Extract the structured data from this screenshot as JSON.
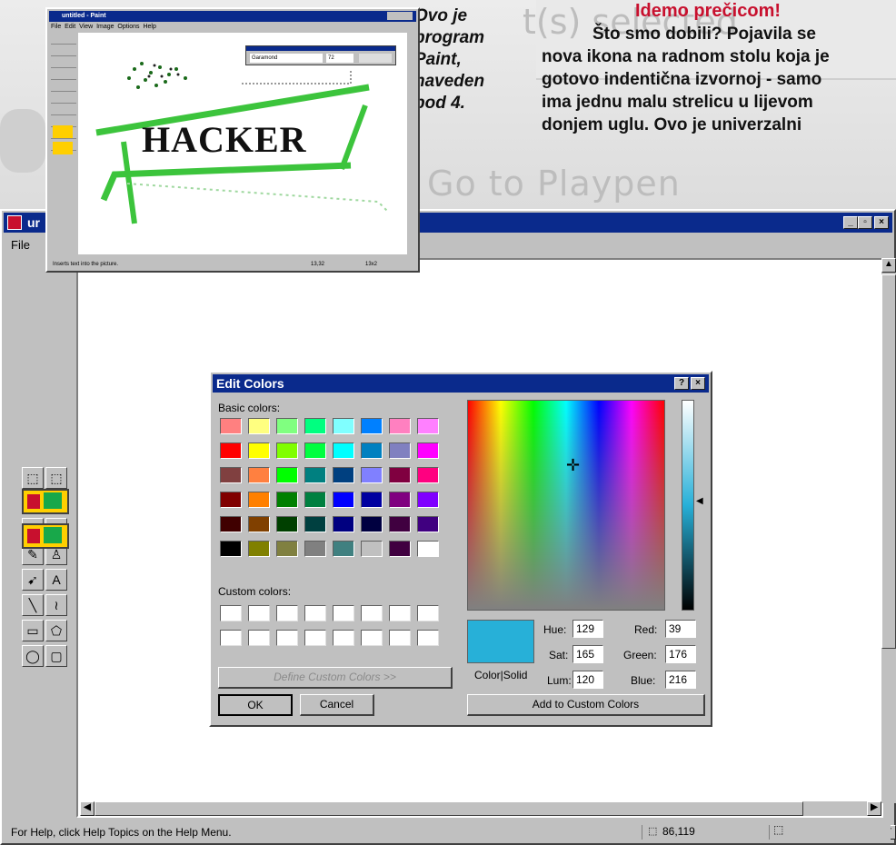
{
  "backdrop": {
    "ghost_text_1": "t(s) selected",
    "ghost_text_2": "Go to Playpen"
  },
  "caption": {
    "lines": [
      "Ovo je",
      "program",
      "Paint,",
      "naveden",
      "pod 4."
    ]
  },
  "article": {
    "heading": "Idemo prečicom!",
    "lines": [
      "Što smo dobili? Pojavila se",
      "nova ikona na radnom stolu koja je",
      "gotovo indentična izvornoj - samo",
      "ima jednu malu strelicu u lijevom",
      "donjem uglu. Ovo je univerzalni"
    ]
  },
  "inset_window": {
    "title": "untitled - Paint",
    "menu": [
      "File",
      "Edit",
      "View",
      "Image",
      "Options",
      "Help"
    ],
    "font_toolbar": {
      "font": "Garamond",
      "size": "72"
    },
    "canvas_text": "HACKER",
    "status": "Inserts text into the picture.",
    "coords_1": "13,32",
    "coords_2": "13x2"
  },
  "main_window": {
    "title": "ur",
    "menu": [
      "File"
    ],
    "status_text": "For Help, click Help Topics on the Help Menu.",
    "cursor_coords": "86,119"
  },
  "tools": [
    {
      "name": "free-form-select-icon",
      "glyph": "⬚"
    },
    {
      "name": "select-icon",
      "glyph": "⬚"
    },
    {
      "name": "eraser-icon",
      "glyph": "◢"
    },
    {
      "name": "fill-icon",
      "glyph": "♦"
    },
    {
      "name": "color-picker-icon",
      "glyph": "⁄"
    },
    {
      "name": "magnifier-icon",
      "glyph": "⚲"
    },
    {
      "name": "pencil-icon",
      "glyph": "✎"
    },
    {
      "name": "brush-icon",
      "glyph": "♙"
    },
    {
      "name": "airbrush-icon",
      "glyph": "➹"
    },
    {
      "name": "text-icon",
      "glyph": "A"
    },
    {
      "name": "line-icon",
      "glyph": "╲"
    },
    {
      "name": "curve-icon",
      "glyph": "≀"
    },
    {
      "name": "rectangle-icon",
      "glyph": "▭"
    },
    {
      "name": "polygon-icon",
      "glyph": "⬠"
    },
    {
      "name": "ellipse-icon",
      "glyph": "◯"
    },
    {
      "name": "rounded-rectangle-icon",
      "glyph": "▢"
    }
  ],
  "dialog": {
    "title": "Edit Colors",
    "help_btn": "?",
    "close_btn": "×",
    "basic_label": "Basic colors:",
    "custom_label": "Custom colors:",
    "define_btn": "Define Custom Colors >>",
    "ok_btn": "OK",
    "cancel_btn": "Cancel",
    "add_btn": "Add to Custom Colors",
    "color_solid_label": "Color|Solid",
    "hue_label": "Hue:",
    "hue": "129",
    "sat_label": "Sat:",
    "sat": "165",
    "lum_label": "Lum:",
    "lum": "120",
    "red_label": "Red:",
    "red": "39",
    "green_label": "Green:",
    "green": "176",
    "blue_label": "Blue:",
    "blue": "216",
    "current_color": "#27b0d8",
    "basic_colors": [
      "#ff8080",
      "#ffff80",
      "#80ff80",
      "#00ff80",
      "#80ffff",
      "#0080ff",
      "#ff80c0",
      "#ff80ff",
      "#ff0000",
      "#ffff00",
      "#80ff00",
      "#00ff40",
      "#00ffff",
      "#0080c0",
      "#8080c0",
      "#ff00ff",
      "#804040",
      "#ff8040",
      "#00ff00",
      "#008080",
      "#004080",
      "#8080ff",
      "#800040",
      "#ff0080",
      "#800000",
      "#ff8000",
      "#008000",
      "#008040",
      "#0000ff",
      "#0000a0",
      "#800080",
      "#8000ff",
      "#400000",
      "#804000",
      "#004000",
      "#004040",
      "#000080",
      "#000040",
      "#400040",
      "#400080",
      "#000000",
      "#808000",
      "#808040",
      "#808080",
      "#408080",
      "#c0c0c0",
      "#400040",
      "#ffffff"
    ]
  }
}
